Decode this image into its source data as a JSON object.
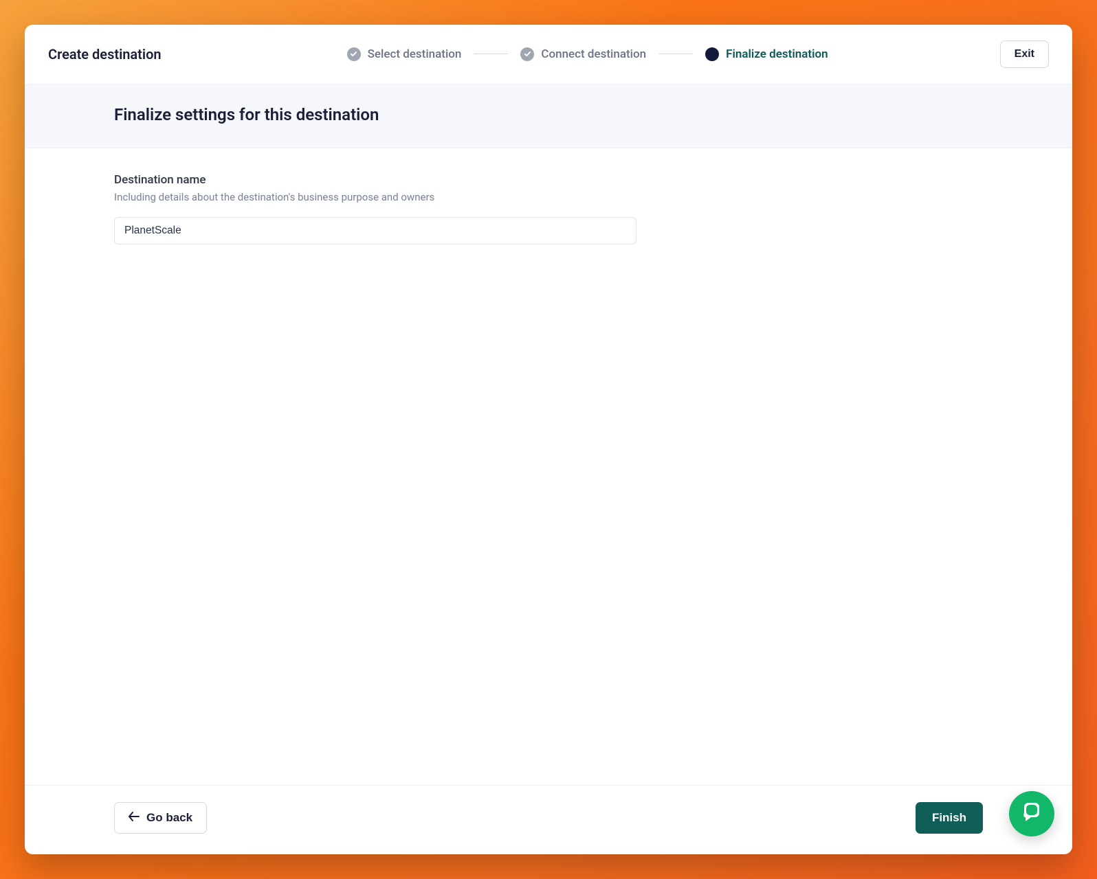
{
  "header": {
    "title": "Create destination",
    "exit_label": "Exit"
  },
  "stepper": {
    "step1": {
      "label": "Select destination"
    },
    "step2": {
      "label": "Connect destination"
    },
    "step3": {
      "label": "Finalize destination"
    }
  },
  "subheader": {
    "heading": "Finalize settings for this destination"
  },
  "form": {
    "name_label": "Destination name",
    "name_help": "Including details about the destination's business purpose and owners",
    "name_value": "PlanetScale"
  },
  "footer": {
    "back_label": "Go back",
    "finish_label": "Finish"
  },
  "icons": {
    "check": "check-icon",
    "dot": "step-current-icon",
    "arrow_left": "arrow-left-icon",
    "chat": "chat-icon"
  }
}
